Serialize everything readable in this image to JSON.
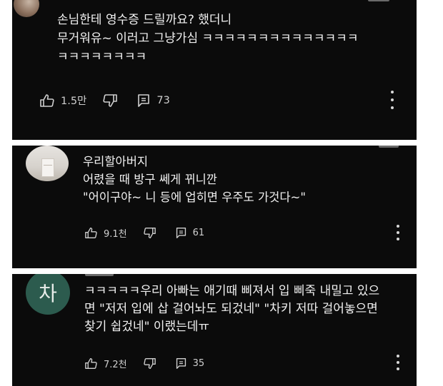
{
  "comments": [
    {
      "lines": [
        "손님한테 영수증 드릴까요? 했더니",
        "무거워유~ 이러고 그냥가심 ㅋㅋㅋㅋㅋㅋㅋㅋㅋㅋㅋㅋㅋㅋ",
        "ㅋㅋㅋㅋㅋㅋㅋㅋ"
      ],
      "likes": "1.5만",
      "replies": "73",
      "avatar": "photo"
    },
    {
      "lines": [
        "우리할아버지",
        "어렸을 때 방구 쎄게 뀌니깐",
        "\"어이구야~ 니 등에 업히면 우주도 가것다~\""
      ],
      "likes": "9.1천",
      "replies": "61",
      "avatar": "room-photo"
    },
    {
      "lines": [
        "ㅋㅋㅋㅋㅋ우리 아빠는 애기때 삐져서 입 삐죽 내밀고 있으",
        "면 \"저저 입에 삽 걸어놔도 되겄네\" \"차키 저따 걸어놓으면",
        "찾기 쉽겄네\" 이랬는데ㅠ"
      ],
      "likes": "7.2천",
      "replies": "35",
      "avatar_letter": "차",
      "avatar_color": "#2c5b4e"
    }
  ],
  "icons": {
    "like": "thumbs-up-icon",
    "dislike": "thumbs-down-icon",
    "reply": "reply-comment-icon",
    "menu": "more-vertical-icon"
  }
}
